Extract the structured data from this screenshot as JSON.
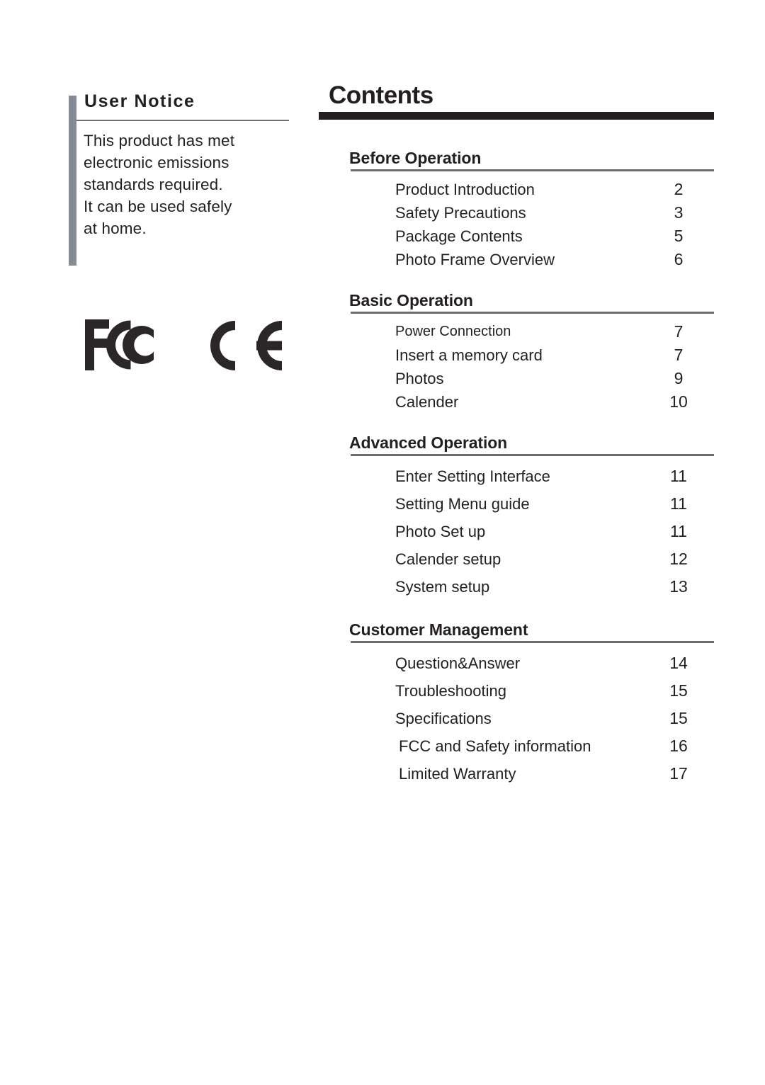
{
  "notice": {
    "title": "User Notice",
    "body_lines": [
      "This product has met",
      "electronic emissions",
      "standards required.",
      "It can be used safely",
      "at home."
    ]
  },
  "certifications": [
    {
      "name": "fcc-logo",
      "label": "FCC"
    },
    {
      "name": "ce-logo",
      "label": "CE"
    }
  ],
  "contents": {
    "title": "Contents",
    "sections": [
      {
        "heading": "Before Operation",
        "items": [
          {
            "label": "Product Introduction",
            "page": "2"
          },
          {
            "label": "Safety Precautions",
            "page": "3"
          },
          {
            "label": "Package Contents",
            "page": "5"
          },
          {
            "label": "Photo Frame Overview",
            "page": "6"
          }
        ]
      },
      {
        "heading": "Basic Operation",
        "items": [
          {
            "label": "Power Connection",
            "page": "7"
          },
          {
            "label": "Insert a memory card",
            "page": "7"
          },
          {
            "label": "Photos",
            "page": "9"
          },
          {
            "label": "Calender",
            "page": "10"
          }
        ]
      },
      {
        "heading": "Advanced Operation",
        "items": [
          {
            "label": "Enter Setting Interface",
            "page": "11"
          },
          {
            "label": "Setting Menu guide",
            "page": "11"
          },
          {
            "label": "Photo Set up",
            "page": "11"
          },
          {
            "label": "Calender setup",
            "page": "12"
          },
          {
            "label": "System setup",
            "page": "13"
          }
        ]
      },
      {
        "heading": "Customer Management",
        "items": [
          {
            "label": "Question&Answer",
            "page": "14"
          },
          {
            "label": "Troubleshooting",
            "page": "15"
          },
          {
            "label": "Specifications",
            "page": "15"
          },
          {
            "label": "FCC and Safety information",
            "page": "16"
          },
          {
            "label": "Limited Warranty",
            "page": "17"
          }
        ]
      }
    ]
  },
  "colors": {
    "ink": "#231f20",
    "accent_bar": "#858b94",
    "rule": "#6b6b6b"
  }
}
